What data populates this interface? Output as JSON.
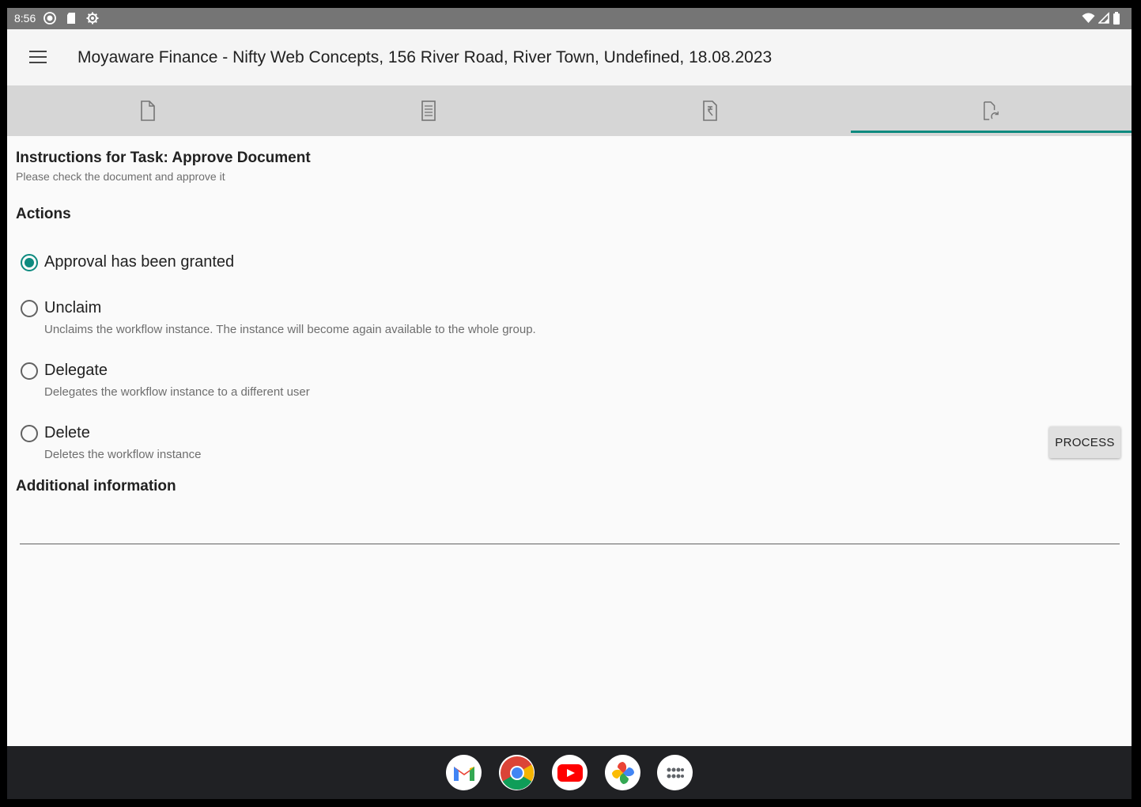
{
  "status_bar": {
    "time": "8:56",
    "icons": [
      "record-icon",
      "sd-card-icon",
      "settings-gear-icon",
      "wifi-icon",
      "signal-icon",
      "battery-icon"
    ]
  },
  "toolbar": {
    "menu_icon": "hamburger-menu-icon",
    "title": "Moyaware Finance - Nifty Web Concepts, 156 River Road, River Town, Undefined, 18.08.2023"
  },
  "tabs": [
    {
      "icon": "document-icon",
      "active": false
    },
    {
      "icon": "checklist-icon",
      "active": false
    },
    {
      "icon": "document-rupee-icon",
      "active": false
    },
    {
      "icon": "document-workflow-icon",
      "active": true
    }
  ],
  "instructions": {
    "title": "Instructions for Task: Approve Document",
    "subtitle": "Please check the document and approve it"
  },
  "actions": {
    "title": "Actions",
    "options": [
      {
        "label": "Approval has been granted",
        "description": "",
        "selected": true
      },
      {
        "label": "Unclaim",
        "description": "Unclaims the workflow instance. The instance will become again available to the whole group.",
        "selected": false
      },
      {
        "label": "Delegate",
        "description": "Delegates the workflow instance to a different user",
        "selected": false
      },
      {
        "label": "Delete",
        "description": "Deletes the workflow instance",
        "selected": false
      }
    ],
    "process_label": "PROCESS"
  },
  "additional_info": {
    "title": "Additional information",
    "value": ""
  },
  "dock": {
    "apps": [
      "gmail-icon",
      "chrome-icon",
      "youtube-icon",
      "photos-icon",
      "app-drawer-icon"
    ]
  },
  "colors": {
    "accent": "#0d8a7f",
    "status_bar": "#757575",
    "tab_bar": "#d6d6d6",
    "nav_bar": "#202124"
  }
}
